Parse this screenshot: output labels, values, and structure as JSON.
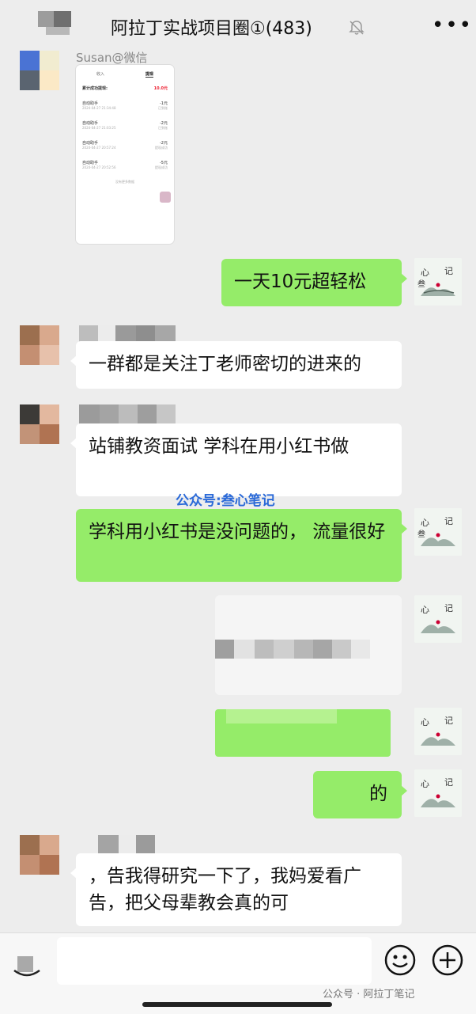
{
  "header": {
    "title": "阿拉丁实战项目圈①(483)"
  },
  "screenshot_card": {
    "sender_name": "Susan@微信",
    "tabs": [
      "收入",
      "提现"
    ],
    "total_label": "累计成功提现:",
    "total_value": "10.0元",
    "items": [
      {
        "name": "自动助手",
        "amount": "-1元",
        "date": "2024-04-27 21:34:48",
        "status": "已到账"
      },
      {
        "name": "自动助手",
        "amount": "-2元",
        "date": "2024-04-27 21:03:25",
        "status": "已到账"
      },
      {
        "name": "自动助手",
        "amount": "-2元",
        "date": "2024-04-27 20:57:24",
        "status": "提现成功"
      },
      {
        "name": "自动助手",
        "amount": "-5元",
        "date": "2024-04-27 20:52:56",
        "status": "提现成功"
      }
    ],
    "end_text": "没有更多数据"
  },
  "messages": [
    {
      "side": "out",
      "text": "一天10元超轻松"
    },
    {
      "side": "in",
      "text": "一群都是关注丁老师密切的进来的"
    },
    {
      "side": "in",
      "text": "站铺教资面试 学科在用小红书做"
    },
    {
      "side": "out",
      "text": "学科用小红书是没问题的， 流量很好"
    },
    {
      "side": "out",
      "text": ""
    },
    {
      "side": "out",
      "text": ""
    },
    {
      "side": "out",
      "text": "的"
    },
    {
      "side": "in",
      "text": "，告我得研究一下了，我妈爱看广告，把父母辈教会真的可"
    }
  ],
  "overlay_watermark": "公众号:叁心笔记",
  "my_avatar_text": "心笔记",
  "footer_watermark": "公众号 · 阿拉丁笔记",
  "icons": [
    "back-icon",
    "mute-bell-icon",
    "more-icon",
    "voice-icon",
    "emoji-icon",
    "plus-icon"
  ],
  "colors": {
    "outgoing": "#95ec69",
    "incoming": "#ffffff",
    "background": "#ededed"
  }
}
